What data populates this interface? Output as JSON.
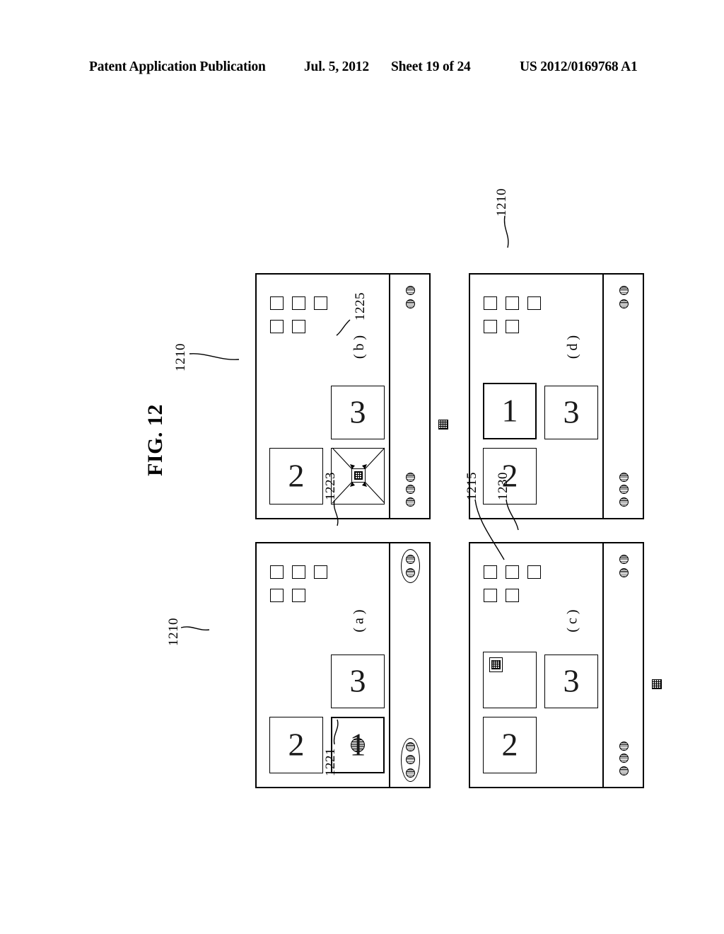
{
  "header": {
    "publication": "Patent Application Publication",
    "date": "Jul. 5, 2012",
    "sheet": "Sheet 19 of 24",
    "pub_number": "US 2012/0169768 A1"
  },
  "figure": {
    "label": "FIG. 12"
  },
  "panels": [
    {
      "id": "a",
      "caption": "( a )",
      "windows": [
        {
          "name": "window-2",
          "glyph": "2",
          "active": false
        },
        {
          "name": "window-1",
          "glyph": "1",
          "active": true
        },
        {
          "name": "window-3",
          "glyph": "3",
          "active": false
        }
      ],
      "refs": [
        {
          "value": "1210",
          "target": "active-window"
        },
        {
          "value": "1223",
          "target": "upper-control-capsule"
        },
        {
          "value": "1221",
          "target": "lower-control-capsule"
        }
      ],
      "tray_buttons": 5,
      "upper_capsule_keys": 3,
      "lower_capsule_keys": 2
    },
    {
      "id": "b",
      "caption": "( b )",
      "windows": [
        {
          "name": "window-2",
          "glyph": "2",
          "active": false
        },
        {
          "name": "window-shrinking",
          "glyph": "",
          "active": false
        },
        {
          "name": "window-3",
          "glyph": "3",
          "active": false
        }
      ],
      "refs": [
        {
          "value": "1210",
          "target": "shrinking-window"
        },
        {
          "value": "1225",
          "target": "detached-icon"
        }
      ],
      "tray_buttons": 5,
      "upper_capsule_keys": 3,
      "lower_capsule_keys": 2
    },
    {
      "id": "c",
      "caption": "( c )",
      "windows": [
        {
          "name": "window-2",
          "glyph": "2",
          "active": false
        },
        {
          "name": "window-target",
          "glyph": "",
          "active": false
        },
        {
          "name": "window-3",
          "glyph": "3",
          "active": false
        }
      ],
      "refs": [
        {
          "value": "1215",
          "target": "dropped-icon"
        },
        {
          "value": "1230",
          "target": "target-window"
        }
      ],
      "tray_buttons": 5,
      "upper_capsule_keys": 3,
      "lower_capsule_keys": 2
    },
    {
      "id": "d",
      "caption": "( d )",
      "windows": [
        {
          "name": "window-2",
          "glyph": "2",
          "active": false
        },
        {
          "name": "window-1",
          "glyph": "1",
          "active": true
        },
        {
          "name": "window-3",
          "glyph": "3",
          "active": false
        }
      ],
      "refs": [
        {
          "value": "1210",
          "target": "restored-window"
        }
      ],
      "tray_buttons": 5,
      "upper_capsule_keys": 3,
      "lower_capsule_keys": 2
    }
  ],
  "colors": {
    "ink": "#000000",
    "paper": "#ffffff",
    "icon_fill": "#d9d9d9"
  }
}
